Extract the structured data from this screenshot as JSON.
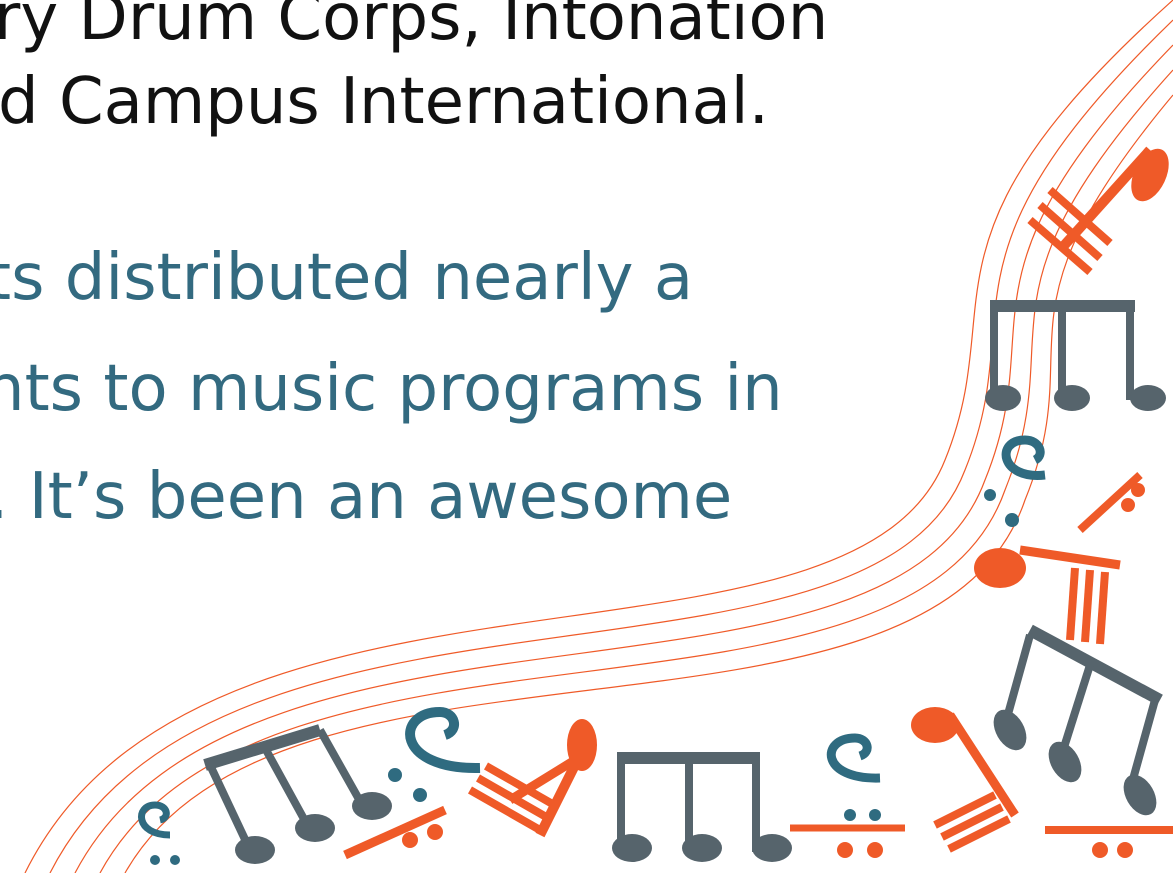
{
  "text": {
    "black_lines": [
      "ry Drum Corps, Intonation",
      "d Campus International."
    ],
    "teal_lines": [
      "ts distributed nearly a",
      "nts to music programs in",
      ". It’s been an awesome"
    ]
  },
  "colors": {
    "black_text": "#111111",
    "teal_text": "#336a80",
    "orange": "#ef5a28",
    "slate": "#56646c",
    "teal_note": "#2f6b80"
  },
  "decoration": {
    "description_icons": [
      "music-staff",
      "eighth-note",
      "beamed-notes",
      "bass-clef"
    ]
  }
}
